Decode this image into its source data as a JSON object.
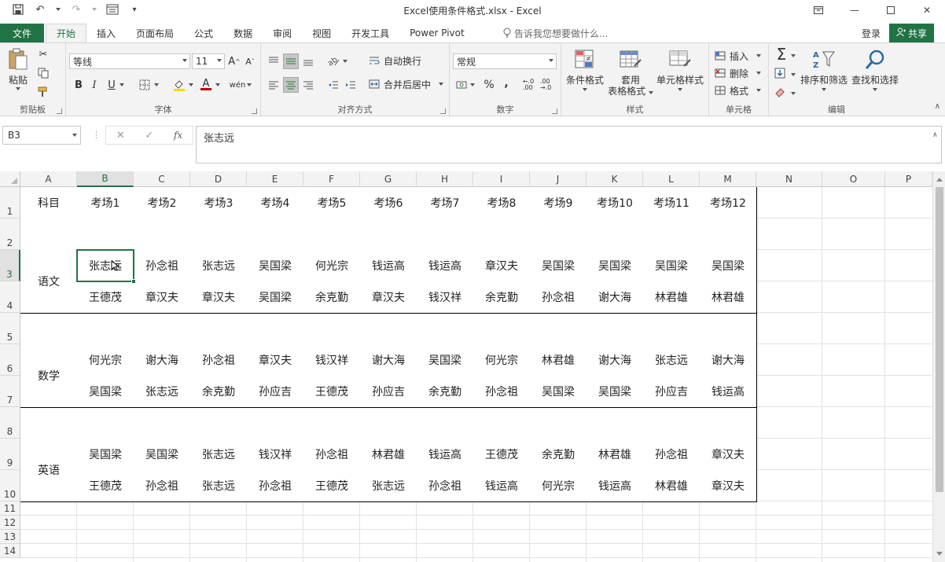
{
  "title": "Excel使用条件格式.xlsx - Excel",
  "tabs": {
    "file": "文件",
    "items": [
      "开始",
      "插入",
      "页面布局",
      "公式",
      "数据",
      "审阅",
      "视图",
      "开发工具",
      "Power Pivot"
    ],
    "tell_me": "告诉我您想要做什么...",
    "login": "登录",
    "share": "共享"
  },
  "ribbon": {
    "clipboard": {
      "paste": "粘贴",
      "label": "剪贴板"
    },
    "font": {
      "name": "等线",
      "size": "11",
      "label": "字体",
      "bold": "B",
      "italic": "I",
      "underline": "U",
      "grow": "A",
      "shrink": "A",
      "color_a": "A",
      "pinyin": "wén"
    },
    "align": {
      "wrap": "自动换行",
      "merge": "合并后居中",
      "label": "对齐方式"
    },
    "number": {
      "format": "常规",
      "label": "数字",
      "percent": "%",
      "comma": ","
    },
    "styles": {
      "cond": "条件格式",
      "table_l1": "套用",
      "table_l2": "表格格式",
      "cell": "单元格样式",
      "label": "样式"
    },
    "cells": {
      "insert": "插入",
      "delete": "删除",
      "format": "格式",
      "label": "单元格"
    },
    "editing": {
      "sort": "排序和筛选",
      "find": "查找和选择",
      "label": "编辑"
    }
  },
  "formula_bar": {
    "name_box": "B3",
    "value": "张志远",
    "fx": "fx"
  },
  "columns": [
    "A",
    "B",
    "C",
    "D",
    "E",
    "F",
    "G",
    "H",
    "I",
    "J",
    "K",
    "L",
    "M",
    "N",
    "O",
    "P"
  ],
  "rows": [
    "1",
    "2",
    "3",
    "4",
    "5",
    "6",
    "7",
    "8",
    "9",
    "10",
    "11",
    "12",
    "13",
    "14"
  ],
  "table": {
    "header": [
      "科目",
      "考场1",
      "考场2",
      "考场3",
      "考场4",
      "考场5",
      "考场6",
      "考场7",
      "考场8",
      "考场9",
      "考场10",
      "考场11",
      "考场12"
    ],
    "subjects": [
      "语文",
      "数学",
      "英语"
    ],
    "data": [
      [
        "张志远",
        "孙念祖",
        "张志远",
        "吴国梁",
        "何光宗",
        "钱运高",
        "钱运高",
        "章汉夫",
        "吴国梁",
        "吴国梁",
        "吴国梁",
        "吴国梁"
      ],
      [
        "王德茂",
        "章汉夫",
        "章汉夫",
        "吴国梁",
        "余克勤",
        "章汉夫",
        "钱汉祥",
        "余克勤",
        "孙念祖",
        "谢大海",
        "林君雄",
        "林君雄"
      ],
      [
        "何光宗",
        "谢大海",
        "孙念祖",
        "章汉夫",
        "钱汉祥",
        "谢大海",
        "吴国梁",
        "何光宗",
        "林君雄",
        "谢大海",
        "张志远",
        "谢大海"
      ],
      [
        "吴国梁",
        "张志远",
        "余克勤",
        "孙应吉",
        "王德茂",
        "孙应吉",
        "余克勤",
        "孙念祖",
        "吴国梁",
        "吴国梁",
        "孙应吉",
        "钱运高"
      ],
      [
        "吴国梁",
        "吴国梁",
        "张志远",
        "钱汉祥",
        "孙念祖",
        "林君雄",
        "钱运高",
        "王德茂",
        "余克勤",
        "林君雄",
        "孙念祖",
        "章汉夫"
      ],
      [
        "王德茂",
        "孙念祖",
        "张志远",
        "孙念祖",
        "王德茂",
        "张志远",
        "孙念祖",
        "钱运高",
        "何光宗",
        "钱运高",
        "林君雄",
        "章汉夫"
      ]
    ]
  }
}
